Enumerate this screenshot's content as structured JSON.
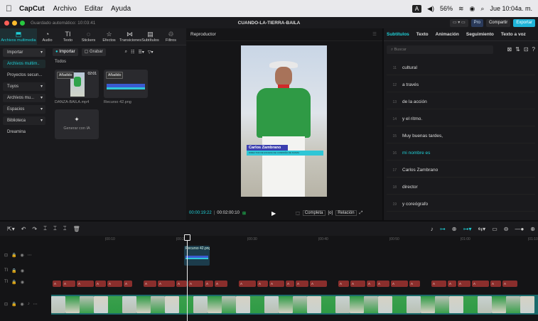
{
  "macbar": {
    "app": "CapCut",
    "menus": [
      "Archivo",
      "Editar",
      "Ayuda"
    ],
    "battery": "56%",
    "datetime": "Jue 10:04a. m."
  },
  "titlebar": {
    "status": "Guardado automático: 10:03:41",
    "project": "CUANDO-LA-TIERRA-BAILA",
    "pro": "Pro",
    "share": "Compartir",
    "export": "Exportar"
  },
  "tools": [
    {
      "label": "Archivos multimedia",
      "icon": "media-icon"
    },
    {
      "label": "Audio",
      "icon": "audio-icon"
    },
    {
      "label": "Texto",
      "icon": "text-icon"
    },
    {
      "label": "Stickers",
      "icon": "stickers-icon"
    },
    {
      "label": "Efectos",
      "icon": "effects-icon"
    },
    {
      "label": "Transiciones",
      "icon": "transitions-icon"
    },
    {
      "label": "Subtítulos",
      "icon": "subtitles-icon"
    },
    {
      "label": "Filtros",
      "icon": "filters-icon"
    }
  ],
  "nav": [
    "Importar",
    "Archivos multim..",
    "Proyectos secun...",
    "Tuyos",
    "Archivos mu...",
    "Espacios",
    "Biblioteca",
    "Dreamina"
  ],
  "media": {
    "import": "Importar",
    "record": "Grabar",
    "section": "Todos",
    "items": [
      {
        "badge": "Añadido",
        "duration": "02:01",
        "name": "DANZA-BAILA.mp4"
      },
      {
        "badge": "Añadido",
        "duration": "",
        "name": "Recurso 42.png"
      }
    ],
    "generate": "Generar con IA"
  },
  "player": {
    "title": "Reproductor",
    "lower_third_name": "Carlos Zambrano",
    "lower_third_role": "DIRECTOR DE ESCENA DE COMPAÑÍA DE DANZA",
    "time_current": "00:00:19:22",
    "time_total": "00:02:00:10",
    "ratio1": "Completa",
    "ratio2": "Relación"
  },
  "right": {
    "tabs": [
      "Subtítulos",
      "Texto",
      "Animación",
      "Seguimiento",
      "Texto a voz"
    ],
    "search": "Buscar",
    "lines": [
      {
        "n": "11",
        "text": "cultural"
      },
      {
        "n": "12",
        "text": "a través"
      },
      {
        "n": "13",
        "text": "de la acción"
      },
      {
        "n": "14",
        "text": "y el ritmo."
      },
      {
        "n": "15",
        "text": "Muy buenas tardes,"
      },
      {
        "n": "16",
        "text": "mi nombre es"
      },
      {
        "n": "17",
        "text": "Carlos Zambrano"
      },
      {
        "n": "18",
        "text": "director"
      },
      {
        "n": "19",
        "text": "y coreógrafo"
      }
    ]
  },
  "timeline": {
    "ruler": [
      "|00:10",
      "|00:20",
      "|00:30",
      "|00:40",
      "|00:50",
      "|01:00",
      "|01:10"
    ],
    "overlay_clip": "Recurso 42.png",
    "text_clip": "A",
    "text_clips_count": 40
  },
  "colors": {
    "accent": "#1fd1d8",
    "export": "#1fb4d8",
    "text_clip": "#8a2e2c",
    "video_track": "#1a6a6b"
  }
}
